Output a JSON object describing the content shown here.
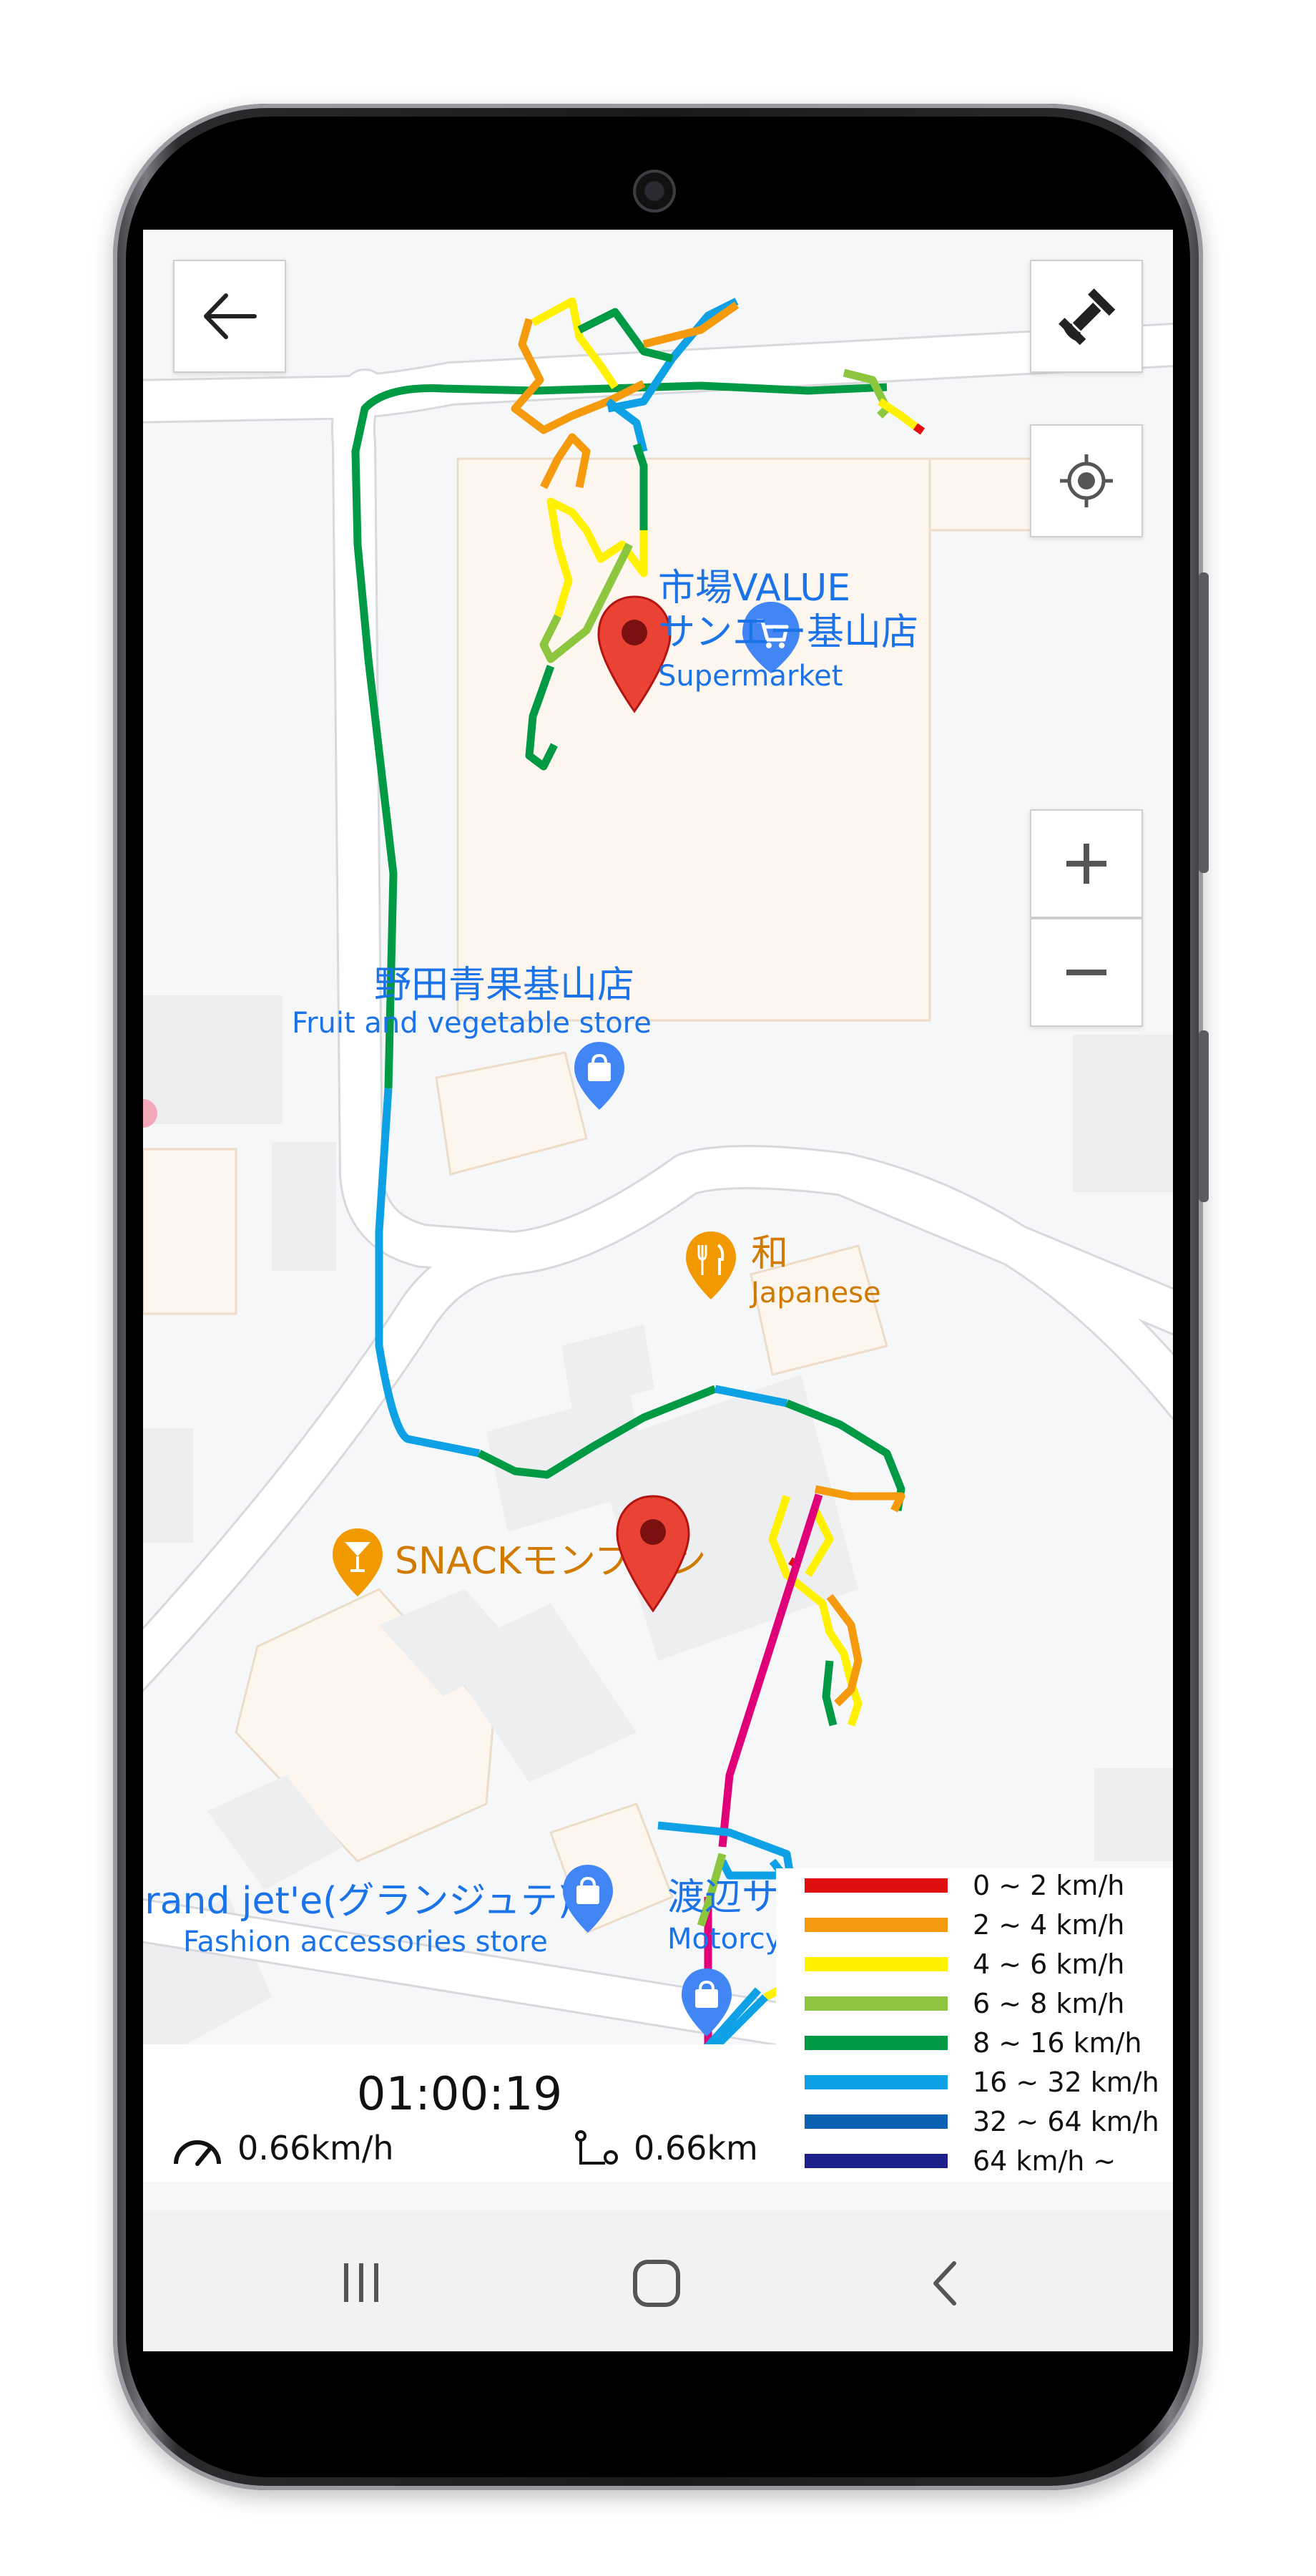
{
  "map": {
    "pois": {
      "supermarket_name_line1": "市場VALUE",
      "supermarket_name_line2": "サンエー基山店",
      "supermarket_category": "Supermarket",
      "fruit_store_name": "野田青果基山店",
      "fruit_store_category": "Fruit and vegetable store",
      "japanese_restaurant_name": "和",
      "japanese_restaurant_category": "Japanese",
      "snack_bar_name": "SNACKモンブラン",
      "fashion_store_name": "Grand jet'e(グランジュテ)",
      "fashion_store_category": "Fashion accessories store",
      "motorcycle_shop_name": "渡辺サ",
      "motorcycle_shop_category": "Motorcy"
    },
    "icons": {
      "back": "arrow-left-icon",
      "gps": "satellite-icon",
      "locate": "my-location-icon",
      "zoom_in": "plus-icon",
      "zoom_out": "minus-icon"
    }
  },
  "legend": {
    "items": [
      {
        "label": "0 ~ 2 km/h",
        "color": "#e00f0f"
      },
      {
        "label": "2 ~ 4 km/h",
        "color": "#f59a0c"
      },
      {
        "label": "4 ~ 6 km/h",
        "color": "#fff100"
      },
      {
        "label": "6 ~ 8 km/h",
        "color": "#8cc63f"
      },
      {
        "label": "8 ~ 16 km/h",
        "color": "#009944"
      },
      {
        "label": "16 ~ 32 km/h",
        "color": "#0ea1e6"
      },
      {
        "label": "32 ~ 64 km/h",
        "color": "#0d61b2"
      },
      {
        "label": "64 km/h ~",
        "color": "#1d2088"
      }
    ]
  },
  "stats": {
    "elapsed_time": "01:00:19",
    "speed": "0.66km/h",
    "distance": "0.66km"
  },
  "colors": {
    "map_background": "#f6f7f8",
    "road": "#ffffff",
    "building": "#eceef0",
    "accent_blue": "#1a73e8",
    "marker_red": "#ea4335",
    "fast_segment_magenta": "#e0007a"
  }
}
